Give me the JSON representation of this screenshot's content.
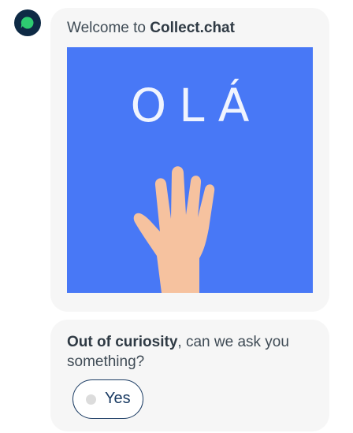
{
  "bot": {
    "avatar_icon": "chat-bubble-icon",
    "avatar_color": "#0e2a45",
    "accent_color": "#2ecc71"
  },
  "welcome": {
    "prefix": "Welcome to ",
    "brand": "Collect.chat"
  },
  "hero": {
    "text": "OLÁ",
    "background": "#4878f6",
    "image_icon": "waving-hand-icon"
  },
  "question": {
    "bold": "Out of curiosity",
    "rest": ", can we ask you something?"
  },
  "options": [
    {
      "label": "Yes"
    }
  ]
}
